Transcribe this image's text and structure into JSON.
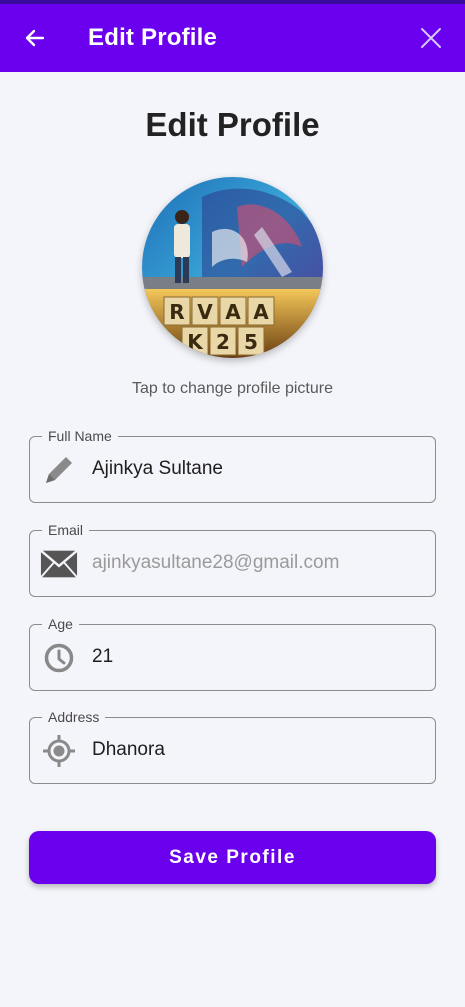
{
  "app_bar": {
    "title": "Edit Profile",
    "back_icon": "arrow-left-icon",
    "close_icon": "close-icon",
    "color": "#6a00ee"
  },
  "page": {
    "heading": "Edit Profile",
    "avatar_hint": "Tap to change profile picture",
    "avatar_sign_letters": [
      "R",
      "V",
      "A",
      "A",
      "K",
      "2",
      "5"
    ]
  },
  "form": {
    "full_name": {
      "label": "Full Name",
      "value": "Ajinkya Sultane",
      "icon": "pencil-icon"
    },
    "email": {
      "label": "Email",
      "placeholder": "ajinkyasultane28@gmail.com",
      "icon": "envelope-icon"
    },
    "age": {
      "label": "Age",
      "value": "21",
      "icon": "clock-icon"
    },
    "address": {
      "label": "Address",
      "value": "Dhanora",
      "icon": "location-target-icon"
    }
  },
  "actions": {
    "save_label": "Save Profile"
  },
  "colors": {
    "accent": "#6a00ee",
    "background": "#f4f5fa"
  }
}
